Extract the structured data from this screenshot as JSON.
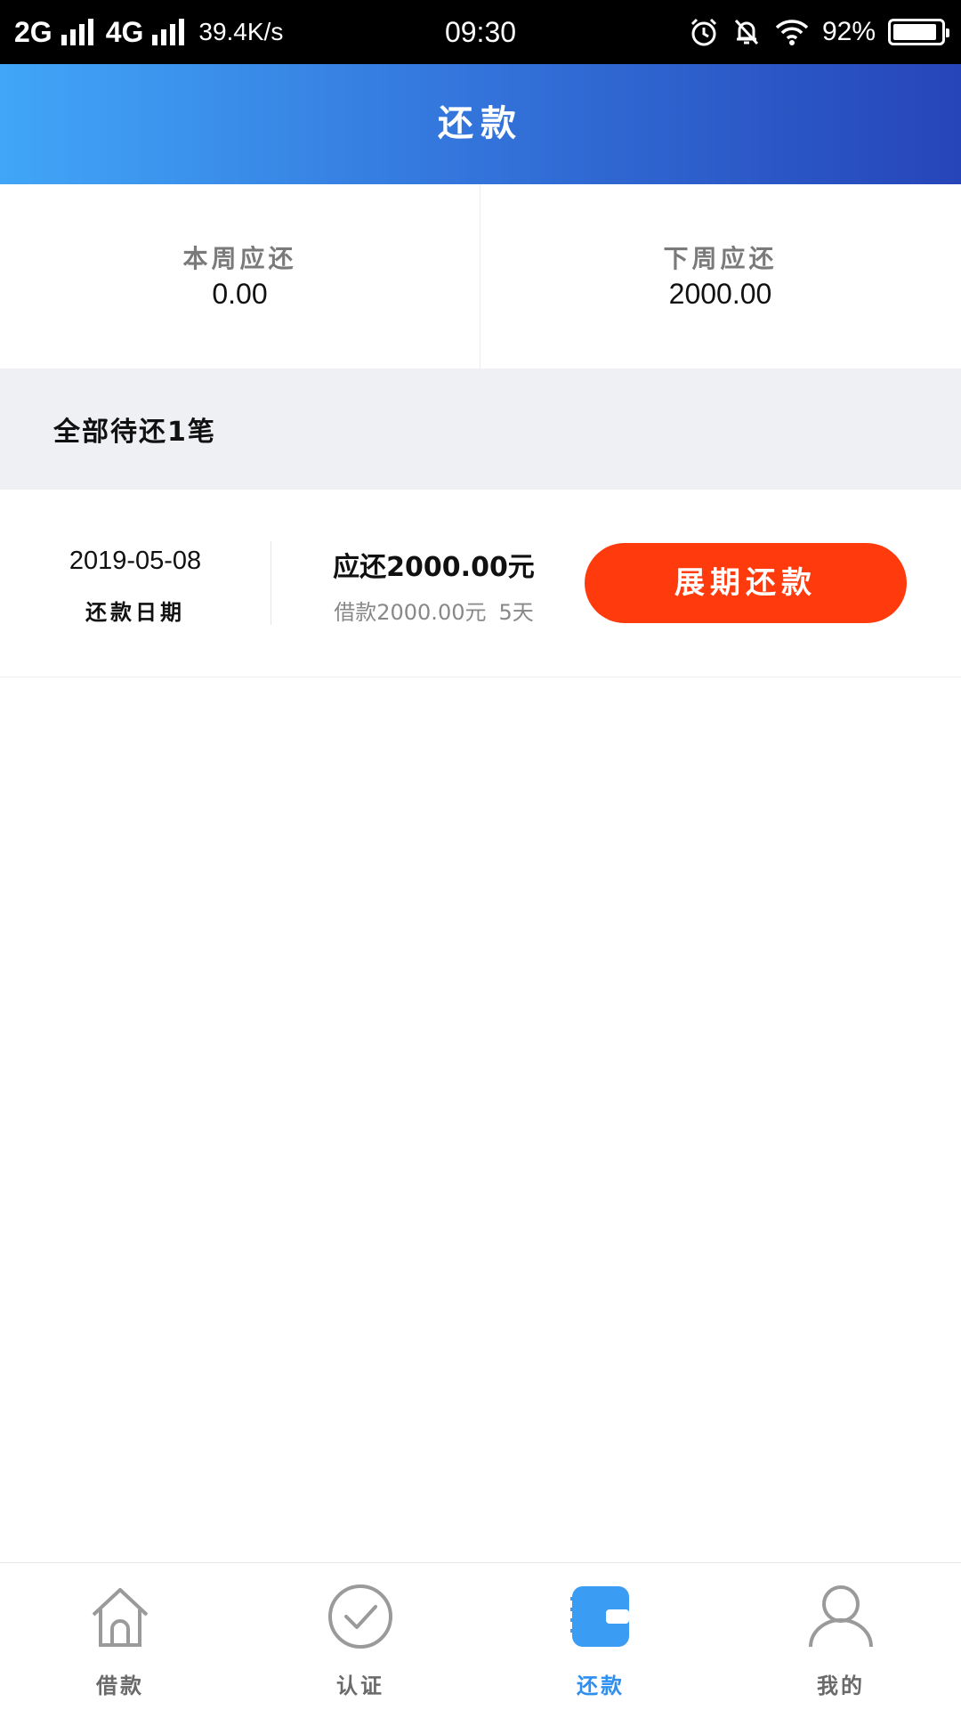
{
  "status_bar": {
    "net1": "2G",
    "net2": "4G",
    "speed": "39.4K/s",
    "time": "09:30",
    "battery_pct": "92%",
    "battery_level": 0.92
  },
  "header": {
    "title": "还款"
  },
  "summary": {
    "this_week_label": "本周应还",
    "this_week_value": "0.00",
    "next_week_label": "下周应还",
    "next_week_value": "2000.00"
  },
  "pending": {
    "title": "全部待还1笔"
  },
  "loan": {
    "due_date": "2019-05-08",
    "due_date_label": "还款日期",
    "due_amount": "应还2000.00元",
    "borrowed": "借款2000.00元",
    "term": "5天",
    "extend_button": "展期还款"
  },
  "tabs": [
    {
      "label": "借款",
      "icon": "home-icon",
      "active": false
    },
    {
      "label": "认证",
      "icon": "check-circle-icon",
      "active": false
    },
    {
      "label": "还款",
      "icon": "wallet-icon",
      "active": true
    },
    {
      "label": "我的",
      "icon": "user-icon",
      "active": false
    }
  ],
  "colors": {
    "header_gradient_start": "#41a6f7",
    "header_gradient_end": "#2645b8",
    "button": "#ff3b0e",
    "active_tab": "#2f8ff0"
  }
}
